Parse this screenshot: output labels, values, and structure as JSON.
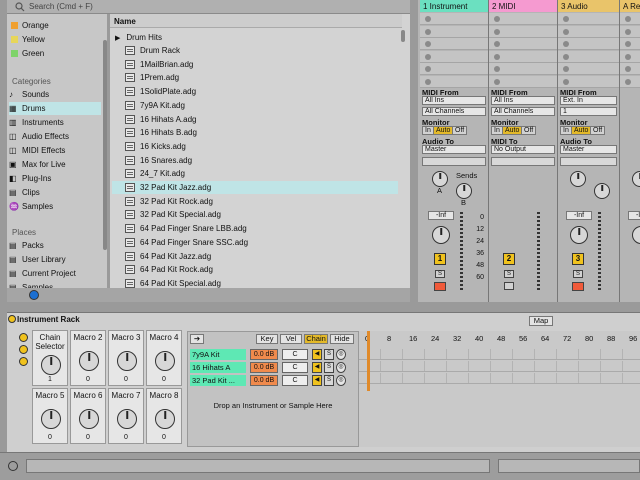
{
  "browser": {
    "search_placeholder": "Search (Cmd + F)",
    "collections": [
      {
        "label": "Orange",
        "color": "#f0a030"
      },
      {
        "label": "Yellow",
        "color": "#e7d65a"
      },
      {
        "label": "Green",
        "color": "#7ed36a"
      }
    ],
    "categories_heading": "Categories",
    "categories": [
      "Sounds",
      "Drums",
      "Instruments",
      "Audio Effects",
      "MIDI Effects",
      "Max for Live",
      "Plug-Ins",
      "Clips",
      "Samples"
    ],
    "selected_category": "Drums",
    "places_heading": "Places",
    "places": [
      "Packs",
      "User Library",
      "Current Project",
      "Samples"
    ],
    "column_header": "Name",
    "folder": "Drum Hits",
    "files": [
      "Drum Rack",
      "1MailBrian.adg",
      "1Prem.adg",
      "1SolidPlate.adg",
      "7y9A Kit.adg",
      "16 Hihats A.adg",
      "16 Hihats B.adg",
      "16 Kicks.adg",
      "16 Snares.adg",
      "24_7 Kit.adg",
      "32 Pad Kit Jazz.adg",
      "32 Pad Kit Rock.adg",
      "32 Pad Kit Special.adg",
      "64 Pad Finger Snare LBB.adg",
      "64 Pad Finger Snare SSC.adg",
      "64 Pad Kit Jazz.adg",
      "64 Pad Kit Rock.adg",
      "64 Pad Kit Special.adg"
    ],
    "selected_file": "32 Pad Kit Jazz.adg"
  },
  "tracks": [
    {
      "name": "1 Instrument",
      "color": "#6be0c0",
      "midi_from": "All Ins",
      "channel": "All Channels",
      "monitor": "Auto",
      "audio_to": "Master",
      "volume": "-Inf",
      "number": "1"
    },
    {
      "name": "2 MIDI",
      "color": "#f59ad0",
      "midi_from": "All Ins",
      "channel": "All Channels",
      "monitor": "Auto",
      "midi_to_label": "MIDI To",
      "audio_to": "No Output",
      "number": "2"
    },
    {
      "name": "3 Audio",
      "color": "#e9c46a",
      "midi_from": "Ext. In",
      "channel": "1",
      "monitor": "Auto",
      "audio_to": "Master",
      "volume": "-Inf",
      "number": "3"
    },
    {
      "name": "A Re",
      "color": "#e9c46a",
      "volume": "-Inf"
    }
  ],
  "mixer": {
    "midi_from_label": "MIDI From",
    "monitor_label": "Monitor",
    "audio_to_label": "Audio To",
    "monitor_options": [
      "In",
      "Auto",
      "Off"
    ],
    "sends_label": "Sends",
    "send_a": "A",
    "send_b": "B",
    "solo": "S",
    "db_scale": [
      "0",
      "12",
      "24",
      "36",
      "48",
      "60"
    ]
  },
  "device": {
    "title": "Instrument Rack",
    "map_button": "Map",
    "macros": [
      {
        "label": "Chain Selector",
        "value": "1"
      },
      {
        "label": "Macro 2",
        "value": "0"
      },
      {
        "label": "Macro 3",
        "value": "0"
      },
      {
        "label": "Macro 4",
        "value": "0"
      },
      {
        "label": "Macro 5",
        "value": "0"
      },
      {
        "label": "Macro 6",
        "value": "0"
      },
      {
        "label": "Macro 7",
        "value": "0"
      },
      {
        "label": "Macro 8",
        "value": "0"
      }
    ],
    "chain_tabs": [
      "Key",
      "Vel",
      "Chain",
      "Hide"
    ],
    "active_tab": "Chain",
    "chains": [
      {
        "name": "7y9A Kit",
        "volume": "0.0 dB",
        "pan": "C"
      },
      {
        "name": "16 Hihats A",
        "volume": "0.0 dB",
        "pan": "C"
      },
      {
        "name": "32 Pad Kit ...",
        "volume": "0.0 dB",
        "pan": "C"
      }
    ],
    "drop_hint": "Drop an Instrument or Sample Here",
    "ruler": [
      "0",
      "8",
      "16",
      "24",
      "32",
      "40",
      "48",
      "56",
      "64",
      "72",
      "80",
      "88",
      "96"
    ]
  }
}
